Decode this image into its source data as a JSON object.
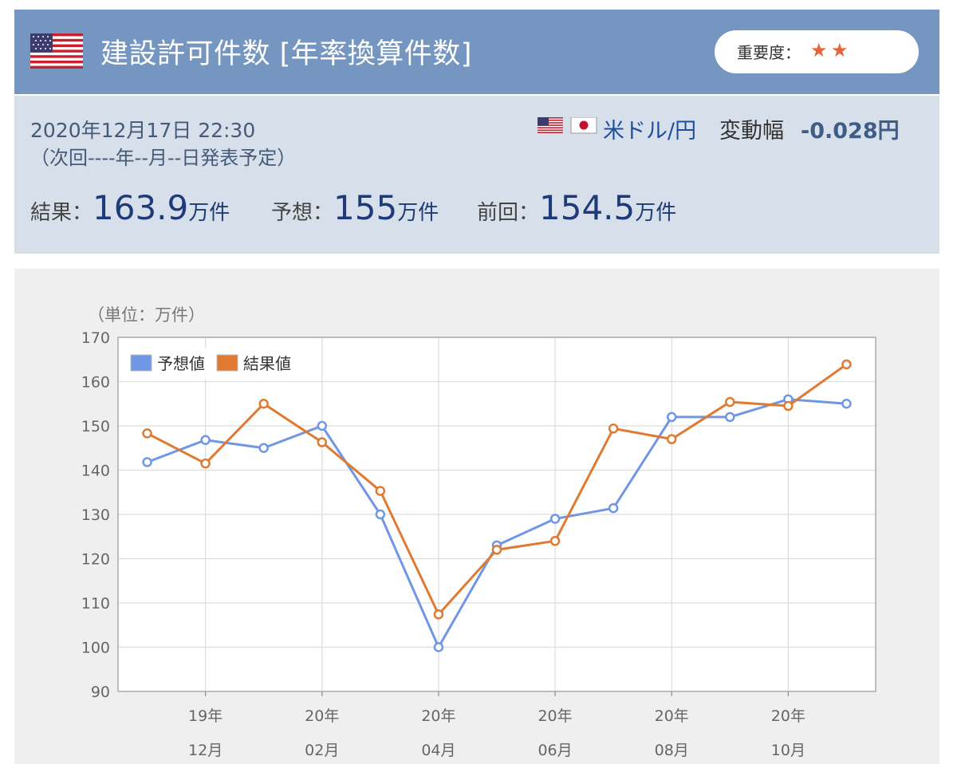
{
  "header": {
    "title": "建設許可件数 [年率換算件数]",
    "flag": "us-flag-icon",
    "importance_label": "重要度：",
    "importance_stars": 2
  },
  "info": {
    "datetime": "2020年12月17日 22:30",
    "next_release": "（次回----年--月--日発表予定）",
    "pair": "米ドル/円",
    "range_label": "変動幅",
    "range_value": "-0.028円",
    "result_label": "結果：",
    "result_value": "163.9",
    "forecast_label": "予想：",
    "forecast_value": "155",
    "previous_label": "前回：",
    "previous_value": "154.5",
    "unit": "万件"
  },
  "colors": {
    "header_bg": "#7496c0",
    "info_bg": "#d7e0ea",
    "forecast": "#6f97e6",
    "result": "#e07a33",
    "star": "#e8633c"
  },
  "chart_data": {
    "type": "line",
    "unit_label": "（単位：万件）",
    "ylim": [
      90,
      170
    ],
    "yticks": [
      90,
      100,
      110,
      120,
      130,
      140,
      150,
      160,
      170
    ],
    "xtick_labels": [
      {
        "index": 1,
        "year": "19年",
        "month": "12月"
      },
      {
        "index": 3,
        "year": "20年",
        "month": "02月"
      },
      {
        "index": 5,
        "year": "20年",
        "month": "04月"
      },
      {
        "index": 7,
        "year": "20年",
        "month": "06月"
      },
      {
        "index": 9,
        "year": "20年",
        "month": "08月"
      },
      {
        "index": 11,
        "year": "20年",
        "month": "10月"
      }
    ],
    "grid": true,
    "legend_position": "top-left",
    "series": [
      {
        "name": "予想値",
        "color": "#6f97e6",
        "values": [
          141.8,
          146.8,
          145,
          150,
          130,
          100,
          123,
          129,
          131.4,
          152,
          152,
          156,
          155
        ]
      },
      {
        "name": "結果値",
        "color": "#e07a33",
        "values": [
          148.3,
          141.5,
          155,
          146.3,
          135.3,
          107.4,
          122,
          124,
          149.4,
          147,
          155.4,
          154.5,
          163.9
        ]
      }
    ]
  }
}
